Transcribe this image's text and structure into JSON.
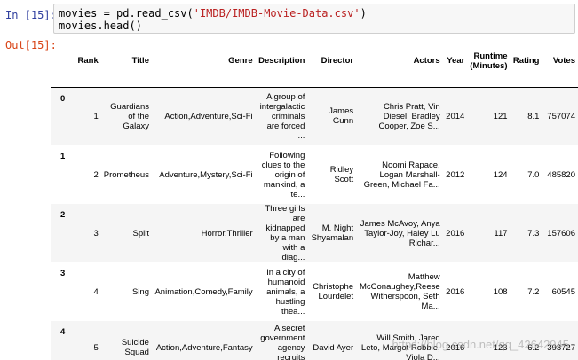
{
  "cell_in": {
    "prompt": "In [15]:",
    "code_line1_a": "movies = pd.read_csv(",
    "code_line1_str": "'IMDB/IMDB-Movie-Data.csv'",
    "code_line1_b": ")",
    "code_line2": "movies.head()"
  },
  "cell_out": {
    "prompt": "Out[15]:"
  },
  "table": {
    "columns": [
      "",
      "Rank",
      "Title",
      "Genre",
      "Description",
      "Director",
      "Actors",
      "Year",
      "Runtime (Minutes)",
      "Rating",
      "Votes"
    ],
    "rows": [
      {
        "index": "0",
        "rank": "1",
        "title": "Guardians of the Galaxy",
        "genre": "Action,Adventure,Sci-Fi",
        "description": "A group of intergalactic criminals are forced ...",
        "director": "James Gunn",
        "actors": "Chris Pratt, Vin Diesel, Bradley Cooper, Zoe S...",
        "year": "2014",
        "runtime": "121",
        "rating": "8.1",
        "votes": "757074"
      },
      {
        "index": "1",
        "rank": "2",
        "title": "Prometheus",
        "genre": "Adventure,Mystery,Sci-Fi",
        "description": "Following clues to the origin of mankind, a te...",
        "director": "Ridley Scott",
        "actors": "Noomi Rapace, Logan Marshall-Green, Michael Fa...",
        "year": "2012",
        "runtime": "124",
        "rating": "7.0",
        "votes": "485820"
      },
      {
        "index": "2",
        "rank": "3",
        "title": "Split",
        "genre": "Horror,Thriller",
        "description": "Three girls are kidnapped by a man with a diag...",
        "director": "M. Night Shyamalan",
        "actors": "James McAvoy, Anya Taylor-Joy, Haley Lu Richar...",
        "year": "2016",
        "runtime": "117",
        "rating": "7.3",
        "votes": "157606"
      },
      {
        "index": "3",
        "rank": "4",
        "title": "Sing",
        "genre": "Animation,Comedy,Family",
        "description": "In a city of humanoid animals, a hustling thea...",
        "director": "Christophe Lourdelet",
        "actors": "Matthew McConaughey,Reese Witherspoon, Seth Ma...",
        "year": "2016",
        "runtime": "108",
        "rating": "7.2",
        "votes": "60545"
      },
      {
        "index": "4",
        "rank": "5",
        "title": "Suicide Squad",
        "genre": "Action,Adventure,Fantasy",
        "description": "A secret government agency recruits some of th...",
        "director": "David Ayer",
        "actors": "Will Smith, Jared Leto, Margot Robbie, Viola D...",
        "year": "2016",
        "runtime": "123",
        "rating": "6.2",
        "votes": "393727"
      }
    ]
  },
  "watermark": "https://blog.csdn.net/qq_42642945"
}
